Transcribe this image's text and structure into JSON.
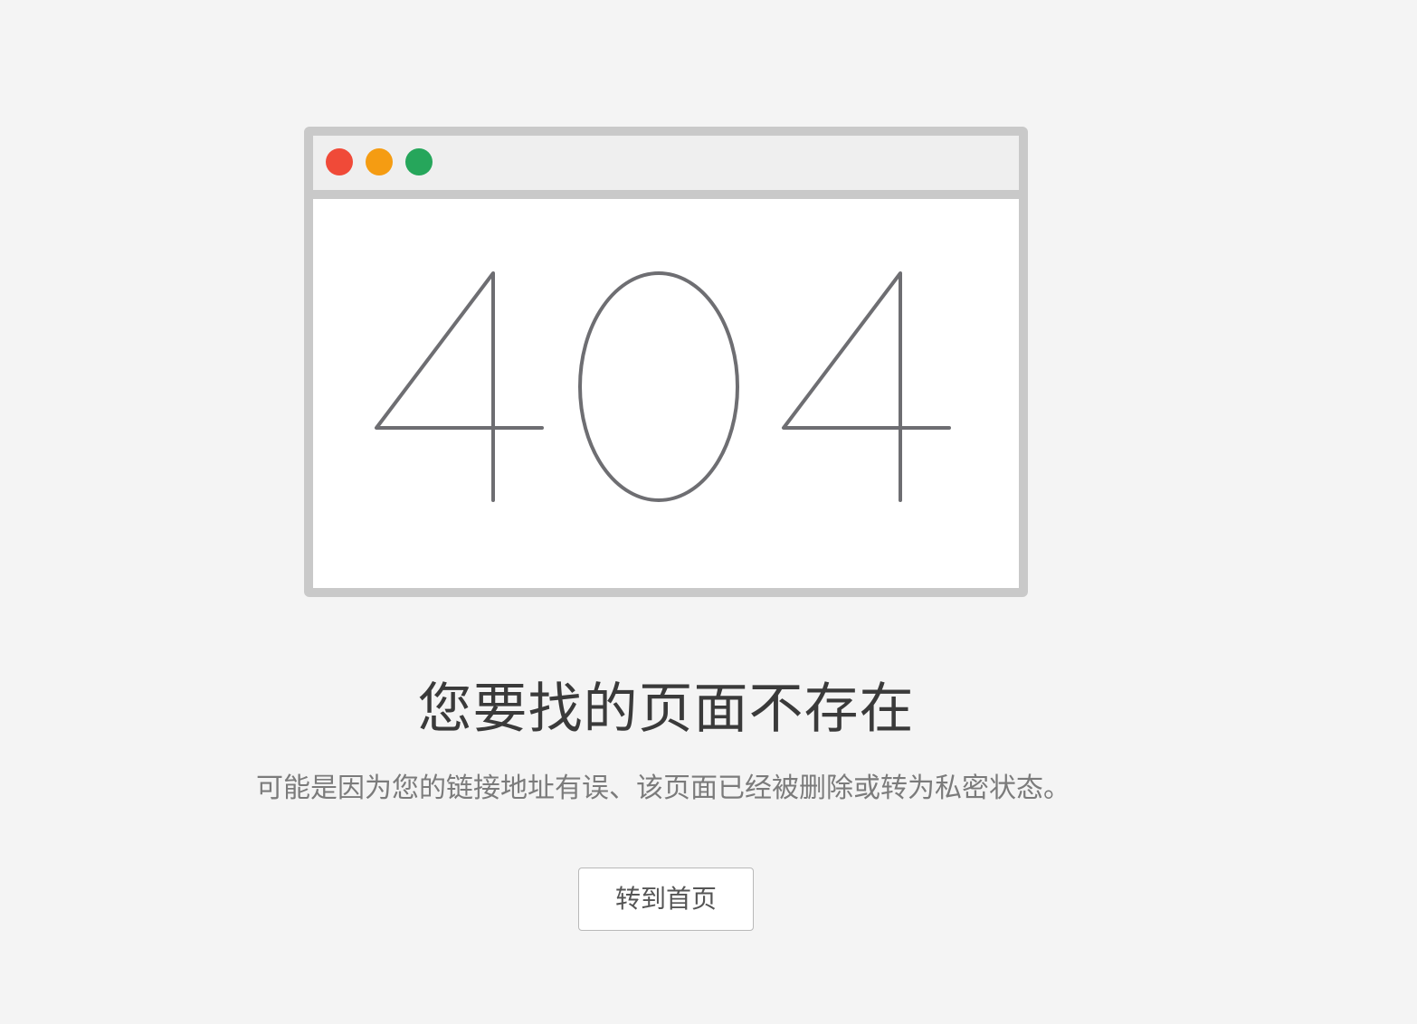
{
  "window_controls": [
    {
      "name": "close",
      "color": "#f04a38"
    },
    {
      "name": "minimize",
      "color": "#f59c12"
    },
    {
      "name": "maximize",
      "color": "#26a65b"
    }
  ],
  "error_code": "404",
  "error_code_color": "#6e6e72",
  "headline": "您要找的页面不存在",
  "subtext": "可能是因为您的链接地址有误、该页面已经被删除或转为私密状态。",
  "home_button_label": "转到首页",
  "colors": {
    "background": "#f4f4f4",
    "frame": "#c9c9c9",
    "titlebar": "#efefef",
    "headline": "#3a3a3a",
    "subtext": "#7b7b7b"
  }
}
